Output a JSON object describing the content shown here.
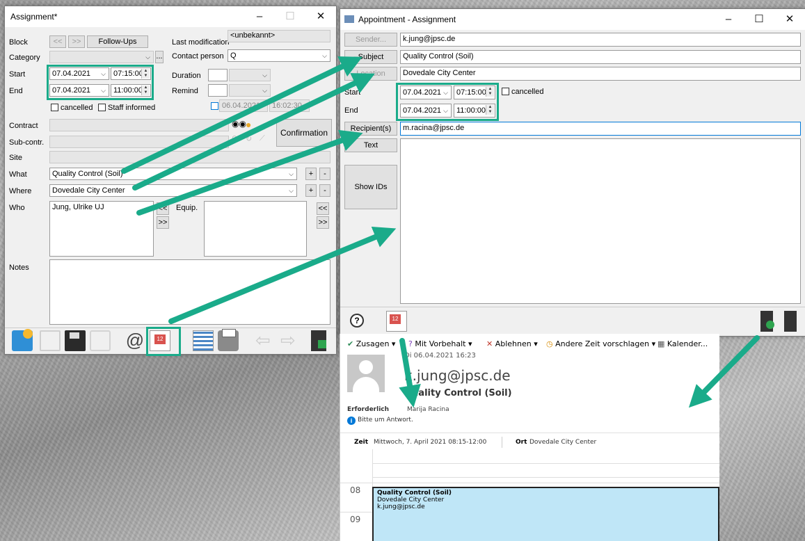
{
  "assignment": {
    "title": "Assignment*",
    "block_label": "Block",
    "nav_prev": "<<",
    "nav_next": ">>",
    "followups_label": "Follow-Ups",
    "last_mod_label": "Last modification",
    "last_mod_value": "<unbekannt>",
    "category_label": "Category",
    "category_value": "",
    "contact_label": "Contact person",
    "contact_value": "Q",
    "start_label": "Start",
    "start_date": "07.04.2021",
    "start_time": "07:15:00",
    "end_label": "End",
    "end_date": "07.04.2021",
    "end_time": "11:00:00",
    "duration_label": "Duration",
    "remind_label": "Remind",
    "remind_date": "06.04.2021",
    "remind_time": "16:02:30",
    "cancelled_label": "cancelled",
    "staff_label": "Staff informed",
    "contract_label": "Contract",
    "subcontr_label": "Sub-contr.",
    "site_label": "Site",
    "confirmation_label": "Confirmation",
    "what_label": "What",
    "what_value": "Quality Control (Soil)",
    "where_label": "Where",
    "where_value": "Dovedale City Center",
    "who_label": "Who",
    "who_value": "Jung, Ulrike UJ",
    "equip_label": "Equip.",
    "notes_label": "Notes",
    "plus": "+",
    "minus": "-",
    "ellipsis": "..."
  },
  "appointment": {
    "title": "Appointment - Assignment",
    "sender_label": "Sender...",
    "sender_value": "k.jung@jpsc.de",
    "subject_label": "Subject",
    "subject_value": "Quality Control (Soil)",
    "location_label": "Location",
    "location_value": "Dovedale City Center",
    "start_label": "Start",
    "start_date": "07.04.2021",
    "start_time": "07:15:00",
    "end_label": "End",
    "end_date": "07.04.2021",
    "end_time": "11:00:00",
    "cancelled_label": "cancelled",
    "recipients_label": "Recipient(s)",
    "recipients_value": "m.racina@jpsc.de",
    "text_label": "Text",
    "showids_label": "Show IDs",
    "help_glyph": "?"
  },
  "outlook": {
    "accept": "Zusagen",
    "tentative": "Mit Vorbehalt",
    "decline": "Ablehnen",
    "propose": "Andere Zeit vorschlagen",
    "calendar": "Kalender...",
    "date": "Di 06.04.2021 16:23",
    "sender": "k.jung@jpsc.de",
    "subject": "Quality Control (Soil)",
    "required_label": "Erforderlich",
    "required_value": "Marija Racina",
    "info": "Bitte um Antwort.",
    "when_label": "Zeit",
    "when_value": "Mittwoch, 7. April 2021 08:15-12:00",
    "where_label": "Ort",
    "where_value": "Dovedale City Center",
    "hour_08": "08",
    "hour_09": "09",
    "event_title": "Quality Control (Soil)",
    "event_location": "Dovedale City Center",
    "event_organizer": "k.jung@jpsc.de"
  },
  "colors": {
    "highlight": "#1aab8a",
    "event_fill": "#bfe6f7",
    "accent": "#0078d7"
  }
}
